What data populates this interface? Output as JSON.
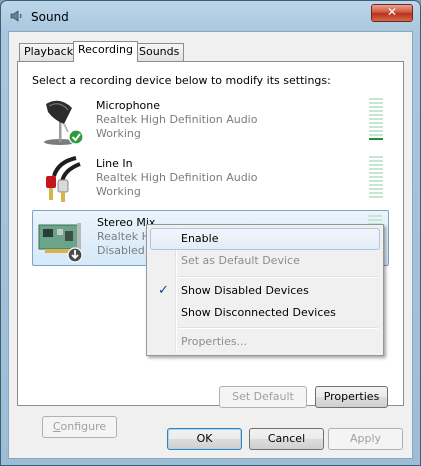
{
  "window": {
    "title": "Sound",
    "close_label": "✕"
  },
  "tabs": [
    {
      "label": "Playback"
    },
    {
      "label": "Recording"
    },
    {
      "label": "Sounds"
    }
  ],
  "instruction": "Select a recording device below to modify its settings:",
  "devices": [
    {
      "name": "Microphone",
      "description": "Realtek High Definition Audio",
      "status": "Working",
      "icon": "microphone-icon",
      "default": true
    },
    {
      "name": "Line In",
      "description": "Realtek High Definition Audio",
      "status": "Working",
      "icon": "line-in-cable-icon",
      "default": false
    },
    {
      "name": "Stereo Mix",
      "description": "Realtek Hi",
      "status": "Disabled",
      "icon": "sound-card-icon",
      "default": false
    }
  ],
  "context_menu": {
    "enable": "Enable",
    "set_default": "Set as Default Device",
    "show_disabled": "Show Disabled Devices",
    "show_disconnected": "Show Disconnected Devices",
    "properties": "Properties...",
    "checkmark": "✓"
  },
  "panel_buttons": {
    "configure": "Configure",
    "set_default": "Set Default",
    "properties": "Properties"
  },
  "dialog_buttons": {
    "ok": "OK",
    "cancel": "Cancel",
    "apply": "Apply"
  },
  "colors": {
    "accent": "#1c8f3b",
    "selection": "#d5e9f8",
    "title_bar": "#a9c7de",
    "close": "#c8442a"
  }
}
